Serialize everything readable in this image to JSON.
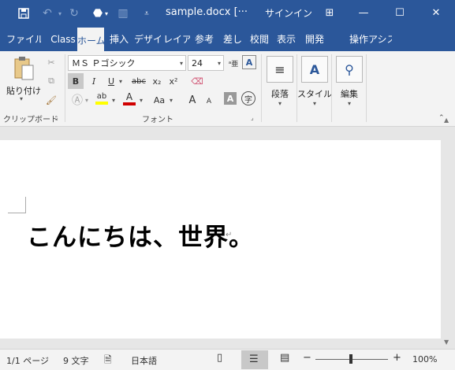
{
  "titlebar": {
    "doc_title": "sample.docx [···",
    "signin": "サインイン",
    "minimize": "—",
    "maximize": "☐",
    "close": "✕",
    "ribbon_toggle": "⊞"
  },
  "tabs": [
    {
      "label": "ファイル",
      "active": false
    },
    {
      "label": "Class",
      "active": false
    },
    {
      "label": "ホーム",
      "active": true
    },
    {
      "label": "挿入",
      "active": false
    },
    {
      "label": "デザイ",
      "active": false
    },
    {
      "label": "レイア",
      "active": false
    },
    {
      "label": "参考",
      "active": false
    },
    {
      "label": "差し",
      "active": false
    },
    {
      "label": "校閲",
      "active": false
    },
    {
      "label": "表示",
      "active": false
    },
    {
      "label": "開発",
      "active": false
    },
    {
      "label": "操作アシス",
      "active": false
    }
  ],
  "ribbon": {
    "clipboard": {
      "paste_label": "貼り付け",
      "group_label": "クリップボード"
    },
    "font": {
      "font_name": "ＭＳ Ｐゴシック",
      "font_size": "24",
      "bold": "B",
      "italic": "I",
      "underline": "U",
      "strikethrough": "abc",
      "subscript": "x₂",
      "superscript": "x²",
      "font_color_letter": "A",
      "grow": "A",
      "shrink": "A",
      "change_case": "Aa",
      "char_shade": "A",
      "enclose": "字",
      "group_label": "フォント"
    },
    "paragraph": {
      "label": "段落"
    },
    "styles": {
      "label": "スタイル"
    },
    "editing": {
      "label": "編集"
    }
  },
  "document": {
    "text": "こんにちは、世界。",
    "paragraph_mark": "↵"
  },
  "statusbar": {
    "page": "1/1 ページ",
    "words": "9 文字",
    "language": "日本語",
    "zoom": "100%",
    "zoom_minus": "−",
    "zoom_plus": "+"
  },
  "colors": {
    "accent": "#2b579a",
    "font_color": "#d00000",
    "highlight": "#ffff00"
  }
}
